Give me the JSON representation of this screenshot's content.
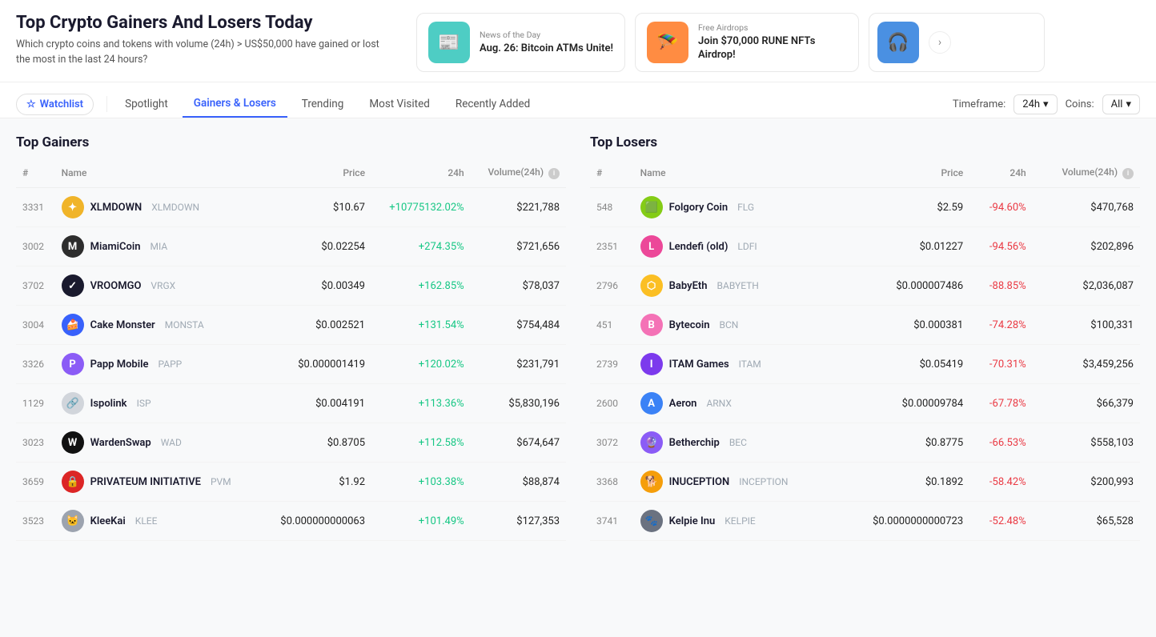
{
  "page": {
    "title": "Top Crypto Gainers And Losers Today",
    "subtitle": "Which crypto coins and tokens with volume (24h) > US$50,000 have gained or lost the most in the last 24 hours?"
  },
  "newsCards": [
    {
      "label": "News of the Day",
      "text": "Aug. 26: Bitcoin ATMs Unite!",
      "iconColor": "teal",
      "icon": "📰"
    },
    {
      "label": "Free Airdrops",
      "text": "Join $70,000 RUNE NFTs Airdrop!",
      "iconColor": "orange",
      "icon": "🪂"
    },
    {
      "iconColor": "blue",
      "icon": "🎧"
    }
  ],
  "nav": {
    "tabs": [
      {
        "label": "Watchlist",
        "key": "watchlist",
        "type": "watchlist"
      },
      {
        "label": "Spotlight",
        "key": "spotlight"
      },
      {
        "label": "Gainers & Losers",
        "key": "gainers-losers",
        "active": true
      },
      {
        "label": "Trending",
        "key": "trending"
      },
      {
        "label": "Most Visited",
        "key": "most-visited"
      },
      {
        "label": "Recently Added",
        "key": "recently-added"
      }
    ],
    "timeframeLabel": "Timeframe:",
    "timeframeValue": "24h",
    "coinsLabel": "Coins:",
    "coinsValue": "All"
  },
  "gainers": {
    "title": "Top Gainers",
    "columns": [
      "#",
      "Name",
      "Price",
      "24h",
      "Volume(24h)"
    ],
    "rows": [
      {
        "rank": "3331",
        "name": "XLMDOWN",
        "symbol": "XLMDOWN",
        "price": "$10.67",
        "change": "+10775132.02%",
        "volume": "$221,788",
        "iconBg": "#f0b429",
        "iconText": "✦"
      },
      {
        "rank": "3002",
        "name": "MiamiCoin",
        "symbol": "MIA",
        "price": "$0.02254",
        "change": "+274.35%",
        "volume": "$721,656",
        "iconBg": "#2d2d2d",
        "iconText": "M"
      },
      {
        "rank": "3702",
        "name": "VROOMGO",
        "symbol": "VRGX",
        "price": "$0.00349",
        "change": "+162.85%",
        "volume": "$78,037",
        "iconBg": "#1a1a2e",
        "iconText": "✓"
      },
      {
        "rank": "3004",
        "name": "Cake Monster",
        "symbol": "MONSTA",
        "price": "$0.002521",
        "change": "+131.54%",
        "volume": "$754,484",
        "iconBg": "#3861fb",
        "iconText": "🍰"
      },
      {
        "rank": "3326",
        "name": "Papp Mobile",
        "symbol": "PAPP",
        "price": "$0.000001419",
        "change": "+120.02%",
        "volume": "$231,791",
        "iconBg": "#8b5cf6",
        "iconText": "P"
      },
      {
        "rank": "1129",
        "name": "Ispolink",
        "symbol": "ISP",
        "price": "$0.004191",
        "change": "+113.36%",
        "volume": "$5,830,196",
        "iconBg": "#d1d5db",
        "iconText": "🔗"
      },
      {
        "rank": "3023",
        "name": "WardenSwap",
        "symbol": "WAD",
        "price": "$0.8705",
        "change": "+112.58%",
        "volume": "$674,647",
        "iconBg": "#111",
        "iconText": "W"
      },
      {
        "rank": "3659",
        "name": "PRIVATEUM INITIATIVE",
        "symbol": "PVM",
        "price": "$1.92",
        "change": "+103.38%",
        "volume": "$88,874",
        "iconBg": "#dc2626",
        "iconText": "🔒"
      },
      {
        "rank": "3523",
        "name": "KleeKai",
        "symbol": "KLEE",
        "price": "$0.000000000063",
        "change": "+101.49%",
        "volume": "$127,353",
        "iconBg": "#9ca3af",
        "iconText": "🐱"
      }
    ]
  },
  "losers": {
    "title": "Top Losers",
    "columns": [
      "#",
      "Name",
      "Price",
      "24h",
      "Volume(24h)"
    ],
    "rows": [
      {
        "rank": "548",
        "name": "Folgory Coin",
        "symbol": "FLG",
        "price": "$2.59",
        "change": "-94.60%",
        "volume": "$470,768",
        "iconBg": "#84cc16",
        "iconText": "🟩"
      },
      {
        "rank": "2351",
        "name": "Lendefi (old)",
        "symbol": "LDFI",
        "price": "$0.01227",
        "change": "-94.56%",
        "volume": "$202,896",
        "iconBg": "#ec4899",
        "iconText": "L"
      },
      {
        "rank": "2796",
        "name": "BabyEth",
        "symbol": "BABYETH",
        "price": "$0.000007486",
        "change": "-88.85%",
        "volume": "$2,036,087",
        "iconBg": "#fbbf24",
        "iconText": "⬡"
      },
      {
        "rank": "451",
        "name": "Bytecoin",
        "symbol": "BCN",
        "price": "$0.000381",
        "change": "-74.28%",
        "volume": "$100,331",
        "iconBg": "#f472b6",
        "iconText": "B"
      },
      {
        "rank": "2739",
        "name": "ITAM Games",
        "symbol": "ITAM",
        "price": "$0.05419",
        "change": "-70.31%",
        "volume": "$3,459,256",
        "iconBg": "#7c3aed",
        "iconText": "I"
      },
      {
        "rank": "2600",
        "name": "Aeron",
        "symbol": "ARNX",
        "price": "$0.00009784",
        "change": "-67.78%",
        "volume": "$66,379",
        "iconBg": "#3b82f6",
        "iconText": "A"
      },
      {
        "rank": "3072",
        "name": "Betherchip",
        "symbol": "BEC",
        "price": "$0.8775",
        "change": "-66.53%",
        "volume": "$558,103",
        "iconBg": "#8b5cf6",
        "iconText": "🔮"
      },
      {
        "rank": "3368",
        "name": "INUCEPTION",
        "symbol": "INCEPTION",
        "price": "$0.1892",
        "change": "-58.42%",
        "volume": "$200,993",
        "iconBg": "#f59e0b",
        "iconText": "🐕"
      },
      {
        "rank": "3741",
        "name": "Kelpie Inu",
        "symbol": "KELPIE",
        "price": "$0.0000000000723",
        "change": "-52.48%",
        "volume": "$65,528",
        "iconBg": "#6b7280",
        "iconText": "🐾"
      }
    ]
  }
}
